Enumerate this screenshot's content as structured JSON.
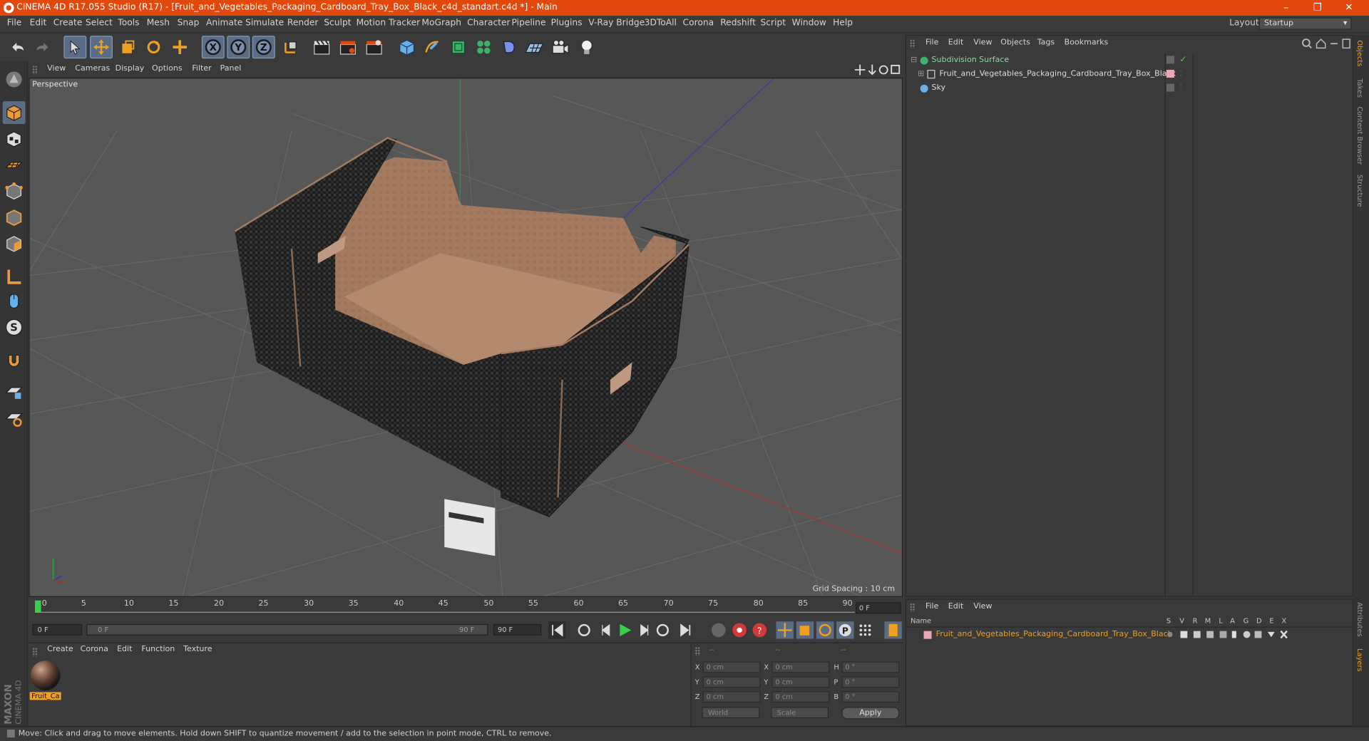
{
  "window": {
    "title": "CINEMA 4D R17.055 Studio (R17) - [Fruit_and_Vegetables_Packaging_Cardboard_Tray_Box_Black_c4d_standart.c4d *] - Main",
    "minimize": "–",
    "restore": "❐",
    "close": "✕",
    "accent_color": "#e2470b"
  },
  "menu": [
    "File",
    "Edit",
    "Create",
    "Select",
    "Tools",
    "Mesh",
    "Snap",
    "Animate",
    "Simulate",
    "Render",
    "Sculpt",
    "Motion Tracker",
    "MoGraph",
    "Character",
    "Pipeline",
    "Plugins",
    "V-Ray Bridge",
    "3DToAll",
    "Corona",
    "Redshift",
    "Script",
    "Window",
    "Help"
  ],
  "layout": {
    "label": "Layout:",
    "value": "Startup"
  },
  "toolbar": {
    "axis_x": "X",
    "axis_y": "Y",
    "axis_z": "Z"
  },
  "viewport": {
    "menu": [
      "View",
      "Cameras",
      "Display",
      "Options",
      "Filter",
      "Panel"
    ],
    "camera_label": "Perspective",
    "grid_spacing": "Grid Spacing : 10 cm"
  },
  "timeline": {
    "ticks": [
      "0",
      "5",
      "10",
      "15",
      "20",
      "25",
      "30",
      "35",
      "40",
      "45",
      "50",
      "55",
      "60",
      "65",
      "70",
      "75",
      "80",
      "85",
      "90"
    ],
    "current_frame_field": "0 F",
    "start_field": "0 F",
    "range_start": "0 F",
    "range_end": "90 F",
    "end_field": "90 F"
  },
  "material_panel": {
    "menu": [
      "Create",
      "Corona",
      "Edit",
      "Function",
      "Texture"
    ],
    "material_name": "Fruit_Ca"
  },
  "coords": {
    "header": [
      "--",
      "--",
      "--"
    ],
    "rows": [
      {
        "a": "X",
        "av": "0 cm",
        "b": "X",
        "bv": "0 cm",
        "c": "H",
        "cv": "0 °"
      },
      {
        "a": "Y",
        "av": "0 cm",
        "b": "Y",
        "bv": "0 cm",
        "c": "P",
        "cv": "0 °"
      },
      {
        "a": "Z",
        "av": "0 cm",
        "b": "Z",
        "bv": "0 cm",
        "c": "B",
        "cv": "0 °"
      }
    ],
    "world": "World",
    "scale": "Scale",
    "apply": "Apply"
  },
  "status": "Move: Click and drag to move elements. Hold down SHIFT to quantize movement / add to the selection in point mode, CTRL to remove.",
  "maxon": {
    "line1": "MAXON",
    "line2": "CINEMA 4D"
  },
  "object_manager": {
    "menu": [
      "File",
      "Edit",
      "View",
      "Objects",
      "Tags",
      "Bookmarks"
    ],
    "objects": [
      {
        "name": "Subdivision Surface",
        "indent": 0
      },
      {
        "name": "Fruit_and_Vegetables_Packaging_Cardboard_Tray_Box_Black",
        "indent": 1
      },
      {
        "name": "Sky",
        "indent": 0
      }
    ]
  },
  "layer_manager": {
    "menu": [
      "File",
      "Edit",
      "View"
    ],
    "columns": [
      "Name",
      "S",
      "V",
      "R",
      "M",
      "L",
      "A",
      "G",
      "D",
      "E",
      "X"
    ],
    "layer_name": "Fruit_and_Vegetables_Packaging_Cardboard_Tray_Box_Black",
    "layer_color": "#e9a020"
  },
  "side_tabs": [
    "Objects",
    "Takes",
    "Content Browser",
    "Structure"
  ],
  "side_tabs_bottom": [
    "Attributes",
    "Layers"
  ]
}
